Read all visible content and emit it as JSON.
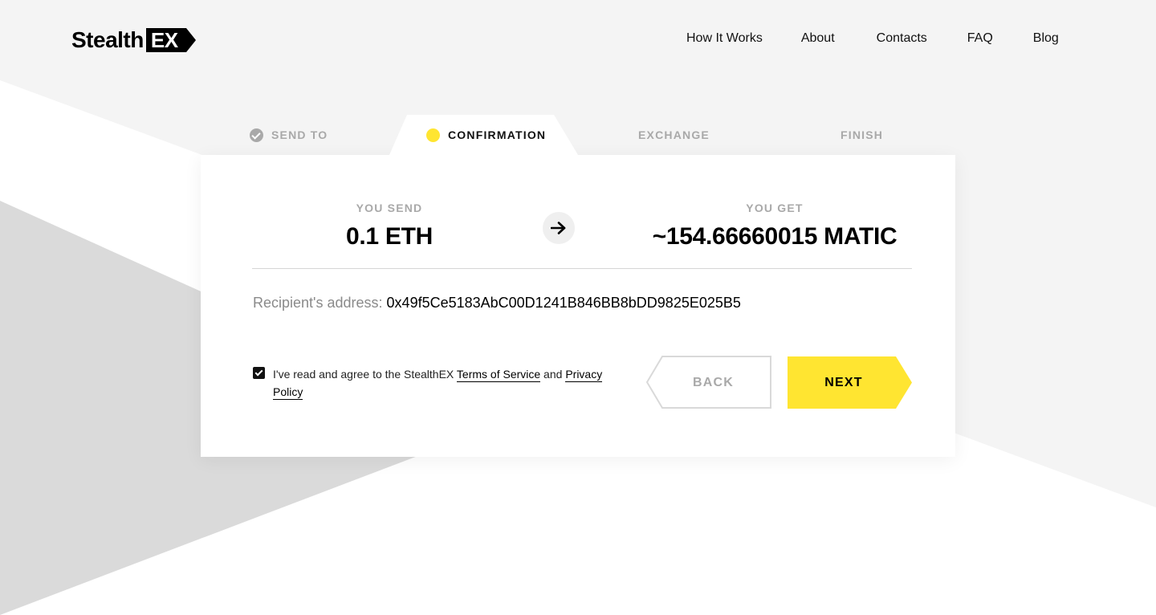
{
  "brand": {
    "logo_text": "Stealth",
    "logo_badge": "EX",
    "accent_color": "#ffe531"
  },
  "nav": {
    "items": [
      "How It Works",
      "About",
      "Contacts",
      "FAQ",
      "Blog"
    ]
  },
  "steps": [
    {
      "label": "SEND TO",
      "state": "done"
    },
    {
      "label": "CONFIRMATION",
      "state": "active"
    },
    {
      "label": "EXCHANGE",
      "state": "pending"
    },
    {
      "label": "FINISH",
      "state": "pending"
    }
  ],
  "exchange": {
    "send_caption": "YOU SEND",
    "send_amount": "0.1 ETH",
    "get_caption": "YOU GET",
    "get_amount": "~154.66660015 MATIC",
    "arrow_icon": "arrow-right-icon"
  },
  "recipient": {
    "label": "Recipient's address:",
    "address": "0x49f5Ce5183AbC00D1241B846BB8bDD9825E025B5"
  },
  "agreement": {
    "checked": true,
    "text_before": "I've read and agree to the StealthEX ",
    "terms_link": "Terms of Service",
    "text_between": " and ",
    "privacy_link": "Privacy Policy"
  },
  "buttons": {
    "back": "BACK",
    "next": "NEXT"
  }
}
